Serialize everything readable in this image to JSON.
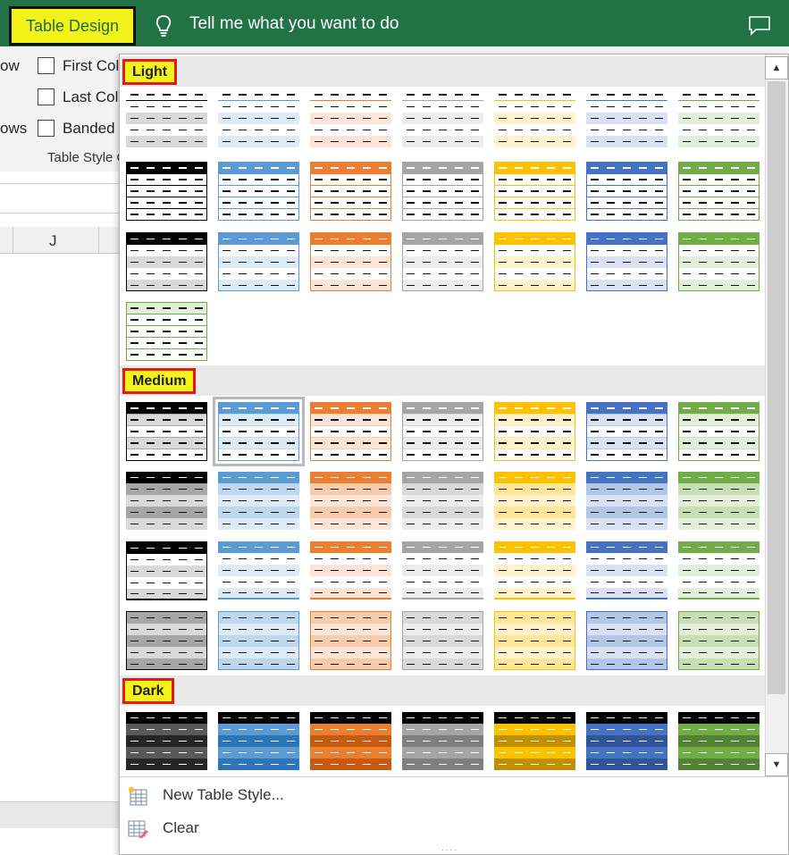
{
  "ribbon": {
    "active_tab": "Table Design",
    "tell_me": "Tell me what you want to do",
    "options": [
      "ow",
      "First Col",
      "Last Col",
      "ows",
      "Banded"
    ],
    "group_label": "Table Style O",
    "column_header": "J"
  },
  "gallery": {
    "sections": [
      "Light",
      "Medium",
      "Dark"
    ],
    "colors": {
      "black": "#000000",
      "blue": "#5b9bd5",
      "orange": "#ed7d31",
      "gray": "#a5a5a5",
      "gold": "#ffc000",
      "darkblue": "#4472c4",
      "green": "#70ad47"
    },
    "selected_style": "Medium 2"
  },
  "menu": {
    "new_style": "New Table Style...",
    "clear": "Clear"
  }
}
